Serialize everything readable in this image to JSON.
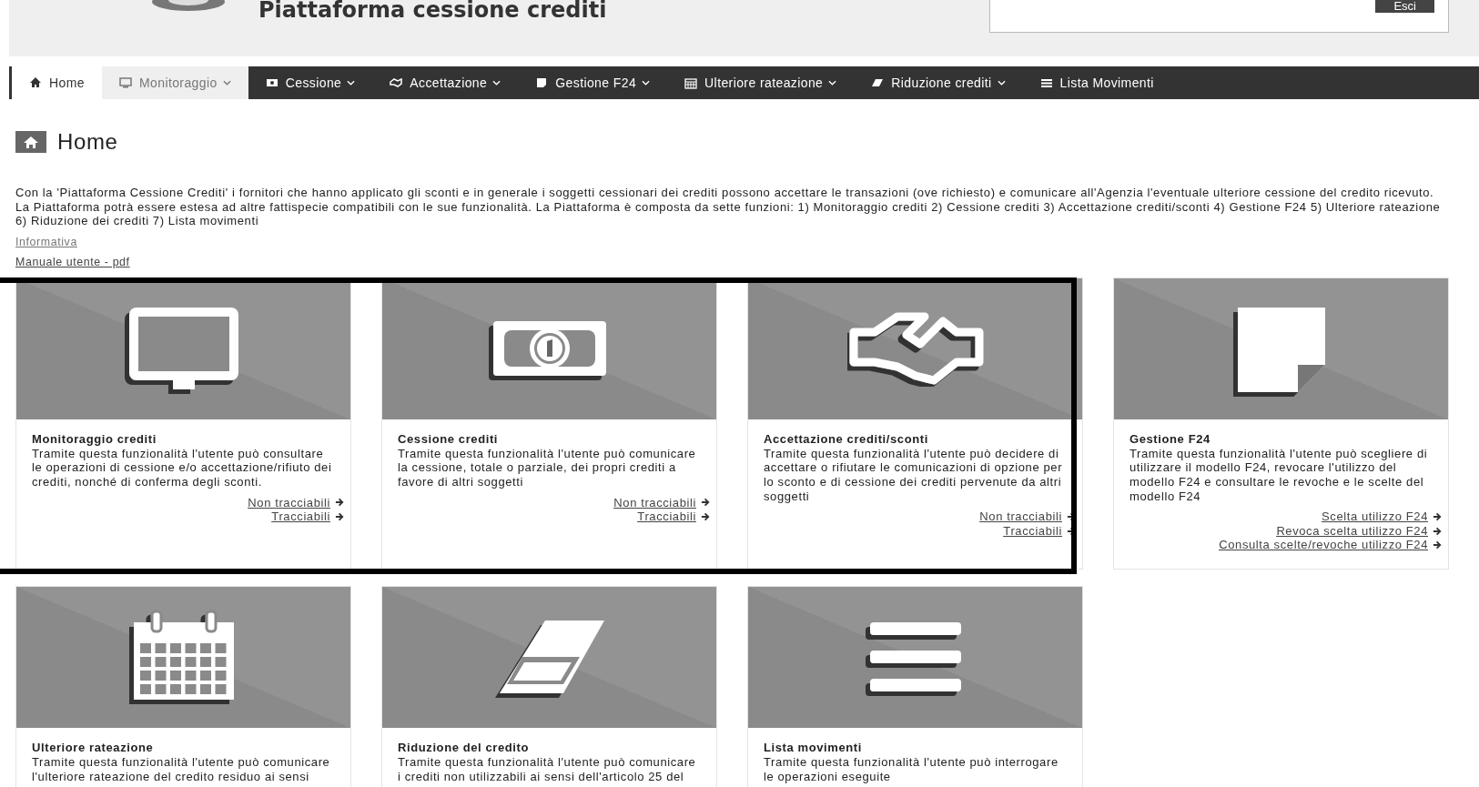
{
  "header": {
    "title": "Piattaforma cessione crediti",
    "logout_button": "Esci"
  },
  "nav": [
    {
      "label": "Home",
      "dropdown": false,
      "selected": true,
      "highlighted": false
    },
    {
      "label": "Monitoraggio",
      "dropdown": true,
      "selected": false,
      "highlighted": true
    },
    {
      "label": "Cessione",
      "dropdown": true,
      "selected": false,
      "highlighted": false
    },
    {
      "label": "Accettazione",
      "dropdown": true,
      "selected": false,
      "highlighted": false
    },
    {
      "label": "Gestione F24",
      "dropdown": true,
      "selected": false,
      "highlighted": false
    },
    {
      "label": "Ulteriore rateazione",
      "dropdown": true,
      "selected": false,
      "highlighted": false
    },
    {
      "label": "Riduzione crediti",
      "dropdown": true,
      "selected": false,
      "highlighted": false
    },
    {
      "label": "Lista Movimenti",
      "dropdown": false,
      "selected": false,
      "highlighted": false
    }
  ],
  "page": {
    "title": "Home",
    "intro": "Con la 'Piattaforma Cessione Crediti' i fornitori che hanno applicato gli sconti e in generale i soggetti cessionari dei crediti possono accettare le transazioni (ove richiesto) e comunicare all'Agenzia l'eventuale ulteriore cessione del credito ricevuto. La Piattaforma potrà essere estesa ad altre fattispecie compatibili con le sue funzionalità. La Piattaforma è composta da sette funzioni: 1) Monitoraggio crediti 2) Cessione crediti 3) Accettazione crediti/sconti 4) Gestione F24 5) Ulteriore rateazione 6) Riduzione dei crediti 7) Lista movimenti",
    "links": [
      "Informativa",
      "Manuale utente - pdf"
    ],
    "cards": [
      {
        "title": "Monitoraggio crediti",
        "description": "Tramite questa funzionalità l'utente può consultare le operazioni di cessione e/o accettazione/rifiuto dei crediti, nonché di conferma degli sconti.",
        "links": [
          "Non tracciabili",
          "Tracciabili"
        ]
      },
      {
        "title": "Cessione crediti",
        "description": "Tramite questa funzionalità l'utente può comunicare la cessione, totale o parziale, dei propri crediti a favore di altri soggetti",
        "links": [
          "Non tracciabili",
          "Tracciabili"
        ]
      },
      {
        "title": "Accettazione crediti/sconti",
        "description": "Tramite questa funzionalità l'utente può decidere di accettare o rifiutare le comunicazioni di opzione per lo sconto e di cessione dei crediti pervenute da altri soggetti",
        "links": [
          "Non tracciabili",
          "Tracciabili"
        ]
      },
      {
        "title": "Gestione F24",
        "description": "Tramite questa funzionalità l'utente può scegliere di utilizzare il modello F24, revocare l'utilizzo del modello F24 e consultare le revoche e le scelte del modello F24",
        "links": [
          "Scelta utilizzo F24",
          "Revoca scelta utilizzo F24",
          "Consulta scelte/revoche utilizzo F24"
        ]
      },
      {
        "title": "Ulteriore rateazione",
        "description": "Tramite questa funzionalità l'utente può comunicare l'ulteriore rateazione del credito residuo ai sensi"
      },
      {
        "title": "Riduzione del credito",
        "description": "Tramite questa funzionalità l'utente può comunicare i crediti non utilizzabili ai sensi dell'articolo 25 del"
      },
      {
        "title": "Lista movimenti",
        "description": "Tramite questa funzionalità l'utente può interrogare le operazioni eseguite"
      }
    ]
  }
}
